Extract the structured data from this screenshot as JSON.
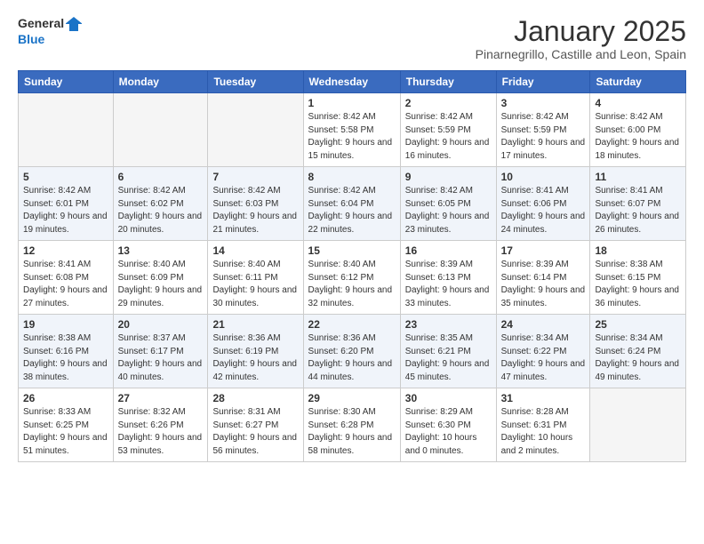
{
  "logo": {
    "line1": "General",
    "line2": "Blue"
  },
  "title": "January 2025",
  "location": "Pinarnegrillo, Castille and Leon, Spain",
  "weekdays": [
    "Sunday",
    "Monday",
    "Tuesday",
    "Wednesday",
    "Thursday",
    "Friday",
    "Saturday"
  ],
  "weeks": [
    [
      {
        "day": "",
        "info": ""
      },
      {
        "day": "",
        "info": ""
      },
      {
        "day": "",
        "info": ""
      },
      {
        "day": "1",
        "info": "Sunrise: 8:42 AM\nSunset: 5:58 PM\nDaylight: 9 hours and 15 minutes."
      },
      {
        "day": "2",
        "info": "Sunrise: 8:42 AM\nSunset: 5:59 PM\nDaylight: 9 hours and 16 minutes."
      },
      {
        "day": "3",
        "info": "Sunrise: 8:42 AM\nSunset: 5:59 PM\nDaylight: 9 hours and 17 minutes."
      },
      {
        "day": "4",
        "info": "Sunrise: 8:42 AM\nSunset: 6:00 PM\nDaylight: 9 hours and 18 minutes."
      }
    ],
    [
      {
        "day": "5",
        "info": "Sunrise: 8:42 AM\nSunset: 6:01 PM\nDaylight: 9 hours and 19 minutes."
      },
      {
        "day": "6",
        "info": "Sunrise: 8:42 AM\nSunset: 6:02 PM\nDaylight: 9 hours and 20 minutes."
      },
      {
        "day": "7",
        "info": "Sunrise: 8:42 AM\nSunset: 6:03 PM\nDaylight: 9 hours and 21 minutes."
      },
      {
        "day": "8",
        "info": "Sunrise: 8:42 AM\nSunset: 6:04 PM\nDaylight: 9 hours and 22 minutes."
      },
      {
        "day": "9",
        "info": "Sunrise: 8:42 AM\nSunset: 6:05 PM\nDaylight: 9 hours and 23 minutes."
      },
      {
        "day": "10",
        "info": "Sunrise: 8:41 AM\nSunset: 6:06 PM\nDaylight: 9 hours and 24 minutes."
      },
      {
        "day": "11",
        "info": "Sunrise: 8:41 AM\nSunset: 6:07 PM\nDaylight: 9 hours and 26 minutes."
      }
    ],
    [
      {
        "day": "12",
        "info": "Sunrise: 8:41 AM\nSunset: 6:08 PM\nDaylight: 9 hours and 27 minutes."
      },
      {
        "day": "13",
        "info": "Sunrise: 8:40 AM\nSunset: 6:09 PM\nDaylight: 9 hours and 29 minutes."
      },
      {
        "day": "14",
        "info": "Sunrise: 8:40 AM\nSunset: 6:11 PM\nDaylight: 9 hours and 30 minutes."
      },
      {
        "day": "15",
        "info": "Sunrise: 8:40 AM\nSunset: 6:12 PM\nDaylight: 9 hours and 32 minutes."
      },
      {
        "day": "16",
        "info": "Sunrise: 8:39 AM\nSunset: 6:13 PM\nDaylight: 9 hours and 33 minutes."
      },
      {
        "day": "17",
        "info": "Sunrise: 8:39 AM\nSunset: 6:14 PM\nDaylight: 9 hours and 35 minutes."
      },
      {
        "day": "18",
        "info": "Sunrise: 8:38 AM\nSunset: 6:15 PM\nDaylight: 9 hours and 36 minutes."
      }
    ],
    [
      {
        "day": "19",
        "info": "Sunrise: 8:38 AM\nSunset: 6:16 PM\nDaylight: 9 hours and 38 minutes."
      },
      {
        "day": "20",
        "info": "Sunrise: 8:37 AM\nSunset: 6:17 PM\nDaylight: 9 hours and 40 minutes."
      },
      {
        "day": "21",
        "info": "Sunrise: 8:36 AM\nSunset: 6:19 PM\nDaylight: 9 hours and 42 minutes."
      },
      {
        "day": "22",
        "info": "Sunrise: 8:36 AM\nSunset: 6:20 PM\nDaylight: 9 hours and 44 minutes."
      },
      {
        "day": "23",
        "info": "Sunrise: 8:35 AM\nSunset: 6:21 PM\nDaylight: 9 hours and 45 minutes."
      },
      {
        "day": "24",
        "info": "Sunrise: 8:34 AM\nSunset: 6:22 PM\nDaylight: 9 hours and 47 minutes."
      },
      {
        "day": "25",
        "info": "Sunrise: 8:34 AM\nSunset: 6:24 PM\nDaylight: 9 hours and 49 minutes."
      }
    ],
    [
      {
        "day": "26",
        "info": "Sunrise: 8:33 AM\nSunset: 6:25 PM\nDaylight: 9 hours and 51 minutes."
      },
      {
        "day": "27",
        "info": "Sunrise: 8:32 AM\nSunset: 6:26 PM\nDaylight: 9 hours and 53 minutes."
      },
      {
        "day": "28",
        "info": "Sunrise: 8:31 AM\nSunset: 6:27 PM\nDaylight: 9 hours and 56 minutes."
      },
      {
        "day": "29",
        "info": "Sunrise: 8:30 AM\nSunset: 6:28 PM\nDaylight: 9 hours and 58 minutes."
      },
      {
        "day": "30",
        "info": "Sunrise: 8:29 AM\nSunset: 6:30 PM\nDaylight: 10 hours and 0 minutes."
      },
      {
        "day": "31",
        "info": "Sunrise: 8:28 AM\nSunset: 6:31 PM\nDaylight: 10 hours and 2 minutes."
      },
      {
        "day": "",
        "info": ""
      }
    ]
  ]
}
